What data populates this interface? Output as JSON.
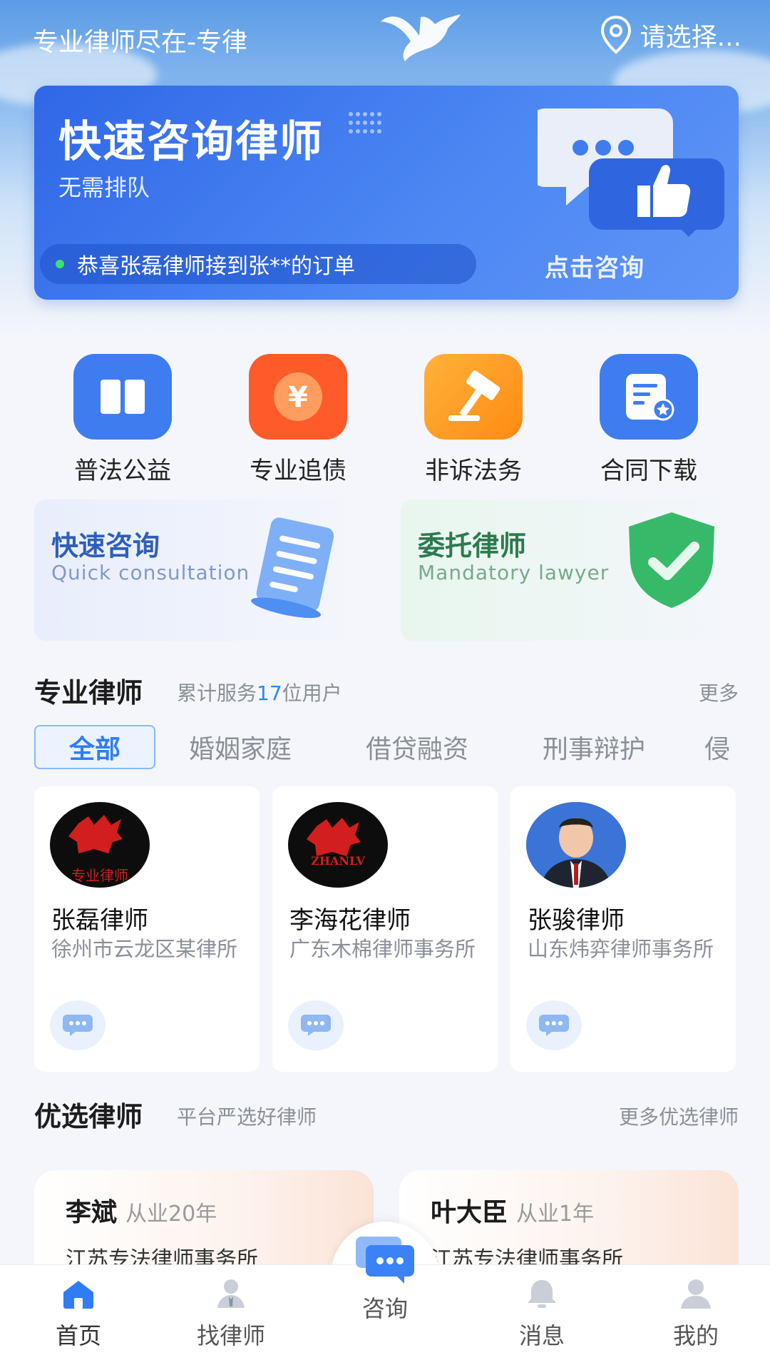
{
  "header": {
    "app_title": "专业律师尽在-专律",
    "location_label": "请选择..."
  },
  "banner": {
    "title": "快速咨询律师",
    "subtitle": "无需排队",
    "notice": "恭喜张磊律师接到张**的订单",
    "cta": "点击咨询"
  },
  "services": [
    {
      "label": "普法公益",
      "icon": "book-icon",
      "color": "#3f7cf0"
    },
    {
      "label": "专业追债",
      "icon": "yen-coin-icon",
      "color": "#ff5a2a"
    },
    {
      "label": "非诉法务",
      "icon": "gavel-icon",
      "color": "#ff9a1a"
    },
    {
      "label": "合同下载",
      "icon": "document-star-icon",
      "color": "#3f7cf0"
    }
  ],
  "quick_cards": [
    {
      "title": "快速咨询",
      "subtitle": "Quick consultation",
      "icon": "scroll-icon",
      "color": "#2f5fb8"
    },
    {
      "title": "委托律师",
      "subtitle": "Mandatory lawyer",
      "icon": "shield-check-icon",
      "color": "#2d7a4e"
    }
  ],
  "pro_section": {
    "title": "专业律师",
    "subtitle_prefix": "累计服务",
    "count": "17",
    "subtitle_suffix": "位用户",
    "more": "更多"
  },
  "tabs": [
    "全部",
    "婚姻家庭",
    "借贷融资",
    "刑事辩护",
    "侵"
  ],
  "lawyers": [
    {
      "name": "张磊律师",
      "firm": "徐州市云龙区某律所",
      "avatar_caption": "专业律师"
    },
    {
      "name": "李海花律师",
      "firm": "广东木棉律师事务所",
      "avatar_caption": "ZHANLV"
    },
    {
      "name": "张骏律师",
      "firm": "山东炜弈律师事务所",
      "avatar_caption": ""
    }
  ],
  "preferred_section": {
    "title": "优选律师",
    "subtitle": "平台严选好律师",
    "more": "更多优选律师"
  },
  "preferred_lawyers": [
    {
      "name": "李斌",
      "years": "从业20年",
      "firm": "江苏专法律师事务所"
    },
    {
      "name": "叶大臣",
      "years": "从业1年",
      "firm": "江苏专法律师事务所"
    }
  ],
  "nav": [
    {
      "label": "首页",
      "icon": "home-icon",
      "active": true
    },
    {
      "label": "找律师",
      "icon": "lawyer-icon",
      "active": false
    },
    {
      "label": "咨询",
      "icon": "chat-icon",
      "active": false
    },
    {
      "label": "消息",
      "icon": "bell-icon",
      "active": false
    },
    {
      "label": "我的",
      "icon": "user-icon",
      "active": false
    }
  ],
  "colors": {
    "accent": "#2f7cf6",
    "banner": "#3a74ea"
  }
}
